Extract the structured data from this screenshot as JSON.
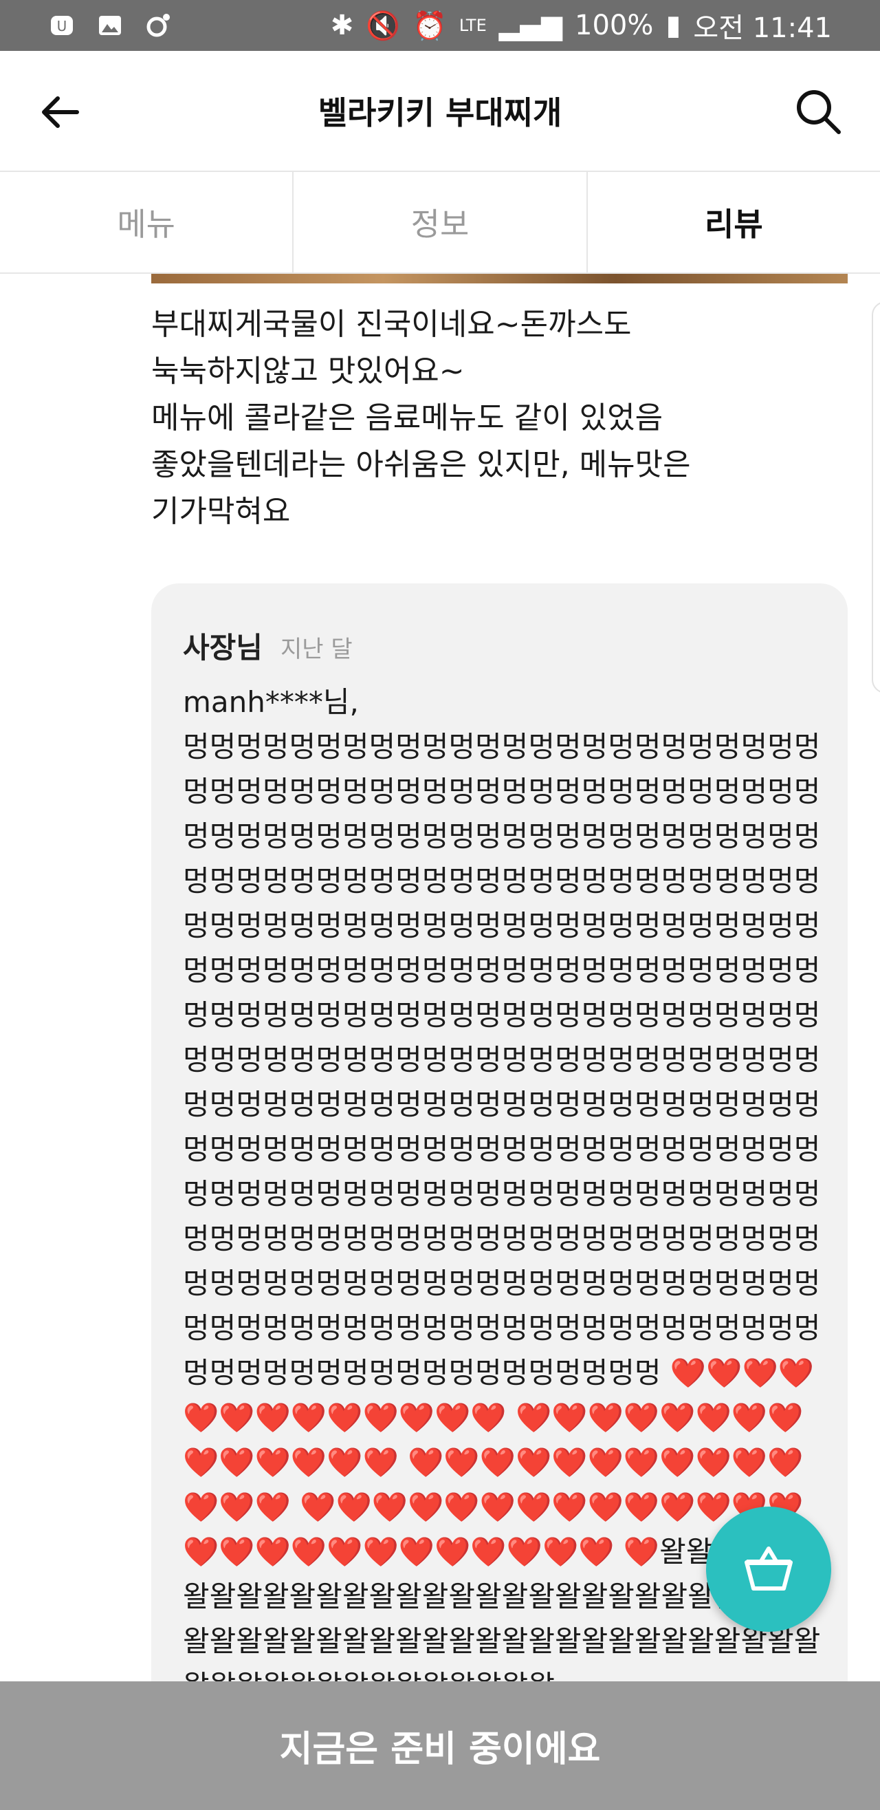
{
  "status_bar": {
    "battery": "100%",
    "time": "오전 11:41",
    "network": "LTE",
    "icons": [
      "u-plus-icon",
      "image-icon",
      "settings-dot-icon",
      "bluetooth-icon",
      "mute-icon",
      "alarm-icon",
      "signal-icon",
      "battery-icon"
    ]
  },
  "app_bar": {
    "title": "벨라키키 부대찌개",
    "back_icon": "arrow-left-icon",
    "search_icon": "search-icon"
  },
  "tabs": [
    {
      "label": "메뉴"
    },
    {
      "label": "정보"
    },
    {
      "label": "리뷰",
      "active": true
    }
  ],
  "review": {
    "text": "부대찌게국물이 진국이네요~돈까스도\n눅눅하지않고 맛있어요~\n메뉴에 콜라같은 음료메뉴도 같이 있었음\n좋았을텐데라는 아쉬움은 있지만, 메뉴맛은\n기가막혀요"
  },
  "owner_reply": {
    "author": "사장님",
    "when": "지난 달",
    "greeting": "manh****님,",
    "body": "멍멍멍멍멍멍멍멍멍멍멍멍멍멍멍멍멍멍멍멍멍멍멍멍멍멍멍멍멍멍멍멍멍멍멍멍멍멍멍멍멍멍멍멍멍멍멍멍멍멍멍멍멍멍멍멍멍멍멍멍멍멍멍멍멍멍멍멍멍멍멍멍멍멍멍멍멍멍멍멍멍멍멍멍멍멍멍멍멍멍멍멍멍멍멍멍멍멍멍멍멍멍멍멍멍멍멍멍멍멍멍멍멍멍멍멍멍멍멍멍멍멍멍멍멍멍멍멍멍멍멍멍멍멍멍멍멍멍멍멍멍멍멍멍멍멍멍멍멍멍멍멍멍멍멍멍멍멍멍멍멍멍멍멍멍멍멍멍멍멍멍멍멍멍멍멍멍멍멍멍멍멍멍멍멍멍멍멍멍멍멍멍멍멍멍멍멍멍멍멍멍멍멍멍멍멍멍멍멍멍멍멍멍멍멍멍멍멍멍멍멍멍멍멍멍멍멍멍멍멍멍멍멍멍멍멍멍멍멍멍멍멍멍멍멍멍멍멍멍멍멍멍멍멍멍멍멍멍멍멍멍멍멍멍멍멍멍멍멍멍멍멍멍멍멍멍멍멍멍멍멍멍멍멍멍멍멍멍멍멍멍멍멍멍멍멍멍멍멍멍멍멍멍멍멍멍멍멍멍멍멍멍멍멍멍멍멍멍멍멍멍멍멍멍멍멍멍멍멍멍멍멍멍멍멍멍멍멍멍멍멍멍멍멍멍멍멍멍멍멍멍멍멍멍 ❤️❤️❤️❤️❤️❤️❤️❤️❤️❤️❤️❤️❤️ ❤️❤️❤️❤️❤️❤️❤️❤️❤️❤️❤️❤️❤️❤️ ❤️❤️❤️❤️❤️❤️❤️❤️❤️❤️❤️❤️❤️❤️ ❤️❤️❤️❤️❤️❤️❤️❤️❤️❤️❤️❤️❤️❤️ ❤️❤️❤️❤️❤️❤️❤️❤️❤️❤️❤️❤️ ❤️왈왈왈왈왈왈왈왈왈왈왈왈왈왈왈왈왈왈왈왈왈왈왈왈왈왈왈왈왈왈왈왈왈왈왈왈왈왈왈왈왈왈왈왈왈왈왈왈왈왈왈왈왈왈왈왈왈왈왈왈왈왈왈왈왈왈왈왈"
  },
  "fab": {
    "icon": "basket-icon"
  },
  "bottom_bar": {
    "label": "지금은 준비 중이에요"
  }
}
